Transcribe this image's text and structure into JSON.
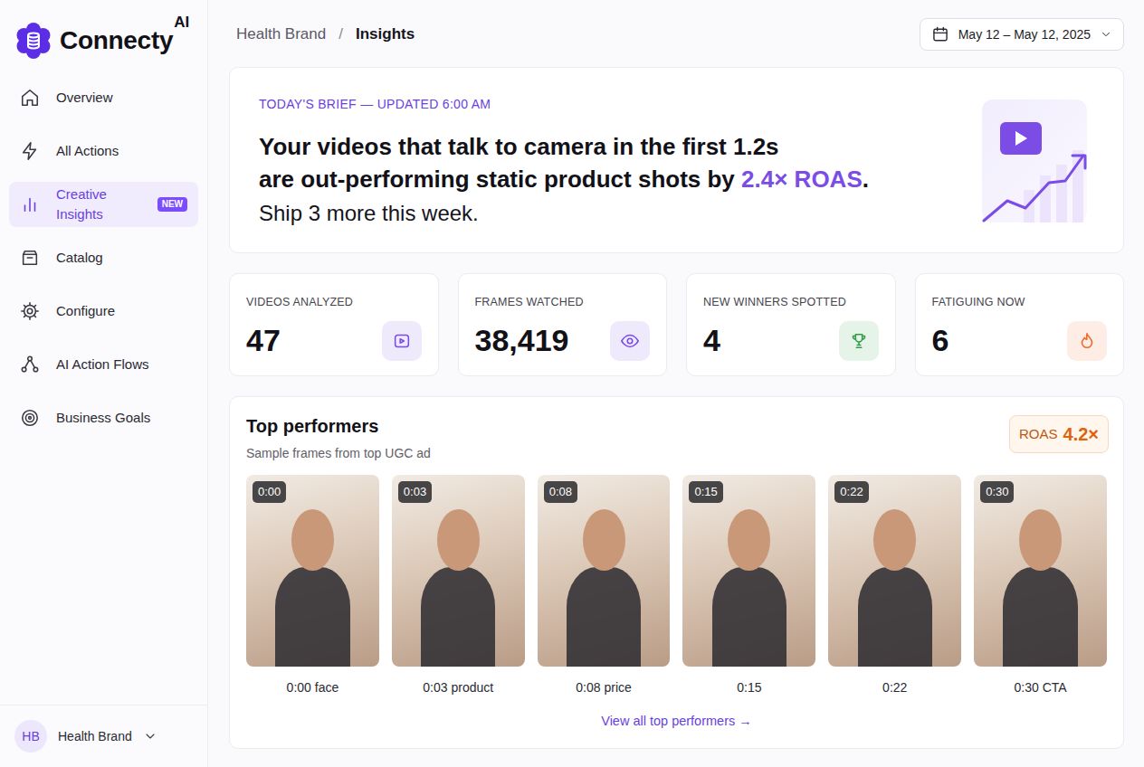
{
  "brand": {
    "name": "Connecty",
    "suffix": "AI"
  },
  "sidebar": {
    "items": [
      {
        "label": "Overview",
        "selected": false
      },
      {
        "label": "All Actions",
        "selected": false
      },
      {
        "label": "Creative Insights",
        "selected": true,
        "badge": "NEW"
      },
      {
        "label": "Catalog",
        "selected": false
      },
      {
        "label": "Configure",
        "selected": false
      },
      {
        "label": "AI Action Flows",
        "selected": false
      },
      {
        "label": "Business Goals",
        "selected": false
      }
    ],
    "account": {
      "initials": "HB",
      "name": "Health Brand"
    }
  },
  "breadcrumb": {
    "items": [
      "Health Brand",
      "Insights"
    ],
    "separator": "/"
  },
  "date_range": "May 12 – May 12, 2025",
  "brief": {
    "eyebrow": "TODAY'S BRIEF — UPDATED 6:00 AM",
    "line1": "Your videos that talk to camera in the first 1.2s",
    "line2": "are out-performing static product shots by ",
    "highlight": "2.4× ROAS",
    "end": ".",
    "action": "Ship 3 more this week."
  },
  "stats": [
    {
      "label": "VIDEOS ANALYZED",
      "value": "47",
      "color": "#7b4ce6"
    },
    {
      "label": "FRAMES WATCHED",
      "value": "38,419",
      "color": "#7b4ce6"
    },
    {
      "label": "NEW WINNERS SPOTTED",
      "value": "4",
      "color": "#2f9e44"
    },
    {
      "label": "FATIGUING NOW",
      "value": "6",
      "color": "#f06b2a"
    }
  ],
  "top_performers": {
    "title": "Top performers",
    "subtitle": "Sample frames from top UGC ad",
    "roas": {
      "label": "ROAS",
      "value": "4.2×"
    },
    "frames": [
      {
        "time": "0:00",
        "caption": "0:00 face"
      },
      {
        "time": "0:03",
        "caption": "0:03 product"
      },
      {
        "time": "0:08",
        "caption": "0:08 price"
      },
      {
        "time": "0:15",
        "caption": "0:15"
      },
      {
        "time": "0:22",
        "caption": "0:22"
      },
      {
        "time": "0:30",
        "caption": "0:30 CTA"
      }
    ],
    "link": "View all top performers →"
  }
}
